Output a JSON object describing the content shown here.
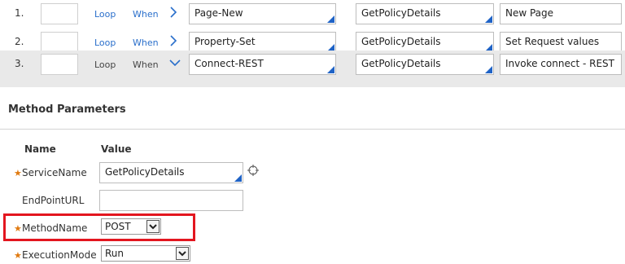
{
  "steps": [
    {
      "num": "1.",
      "loop": "Loop",
      "when": "When",
      "chevron": ">",
      "method": "Page-New",
      "step_page": "GetPolicyDetails",
      "description": "New Page"
    },
    {
      "num": "2.",
      "loop": "Loop",
      "when": "When",
      "chevron": ">",
      "method": "Property-Set",
      "step_page": "GetPolicyDetails",
      "description": "Set Request values"
    },
    {
      "num": "3.",
      "loop": "Loop",
      "when": "When",
      "chevron": "v",
      "method": "Connect-REST",
      "step_page": "GetPolicyDetails",
      "description": "Invoke connect - REST"
    }
  ],
  "method_parameters": {
    "title": "Method Parameters",
    "name_header": "Name",
    "value_header": "Value",
    "params": [
      {
        "label": "ServiceName",
        "value": "GetPolicyDetails",
        "required": true
      },
      {
        "label": "EndPointURL",
        "value": "",
        "required": false
      },
      {
        "label": "MethodName",
        "value": "POST",
        "required": true
      },
      {
        "label": "ExecutionMode",
        "value": "Run",
        "required": true
      }
    ],
    "required_marker": "★"
  },
  "colors": {
    "highlight_box": "#e3161f",
    "link_blue": "#2a6fcb",
    "required_star": "#e07a10"
  },
  "icons": {
    "expand": "chevron-right-icon",
    "collapse": "chevron-down-icon",
    "gadget": "crosshair-icon",
    "dropdown": "dropdown-arrow-icon"
  }
}
